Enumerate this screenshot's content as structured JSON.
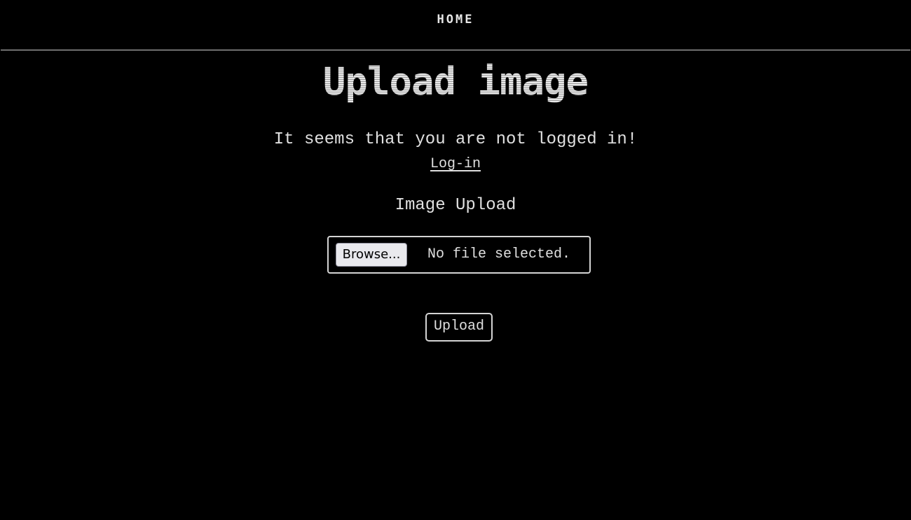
{
  "nav": {
    "home_label": "HOME"
  },
  "page": {
    "title": "Upload image",
    "notice": "It seems that you are not logged in!",
    "login_link": "Log-in",
    "section_title": "Image Upload"
  },
  "file_input": {
    "browse_label": "Browse...",
    "status": "No file selected."
  },
  "upload_button": {
    "label": "Upload"
  },
  "colors": {
    "background": "#000000",
    "text": "#e0e0e0",
    "border": "#d4d4d4",
    "browse_button_bg": "#e9e9ed"
  }
}
